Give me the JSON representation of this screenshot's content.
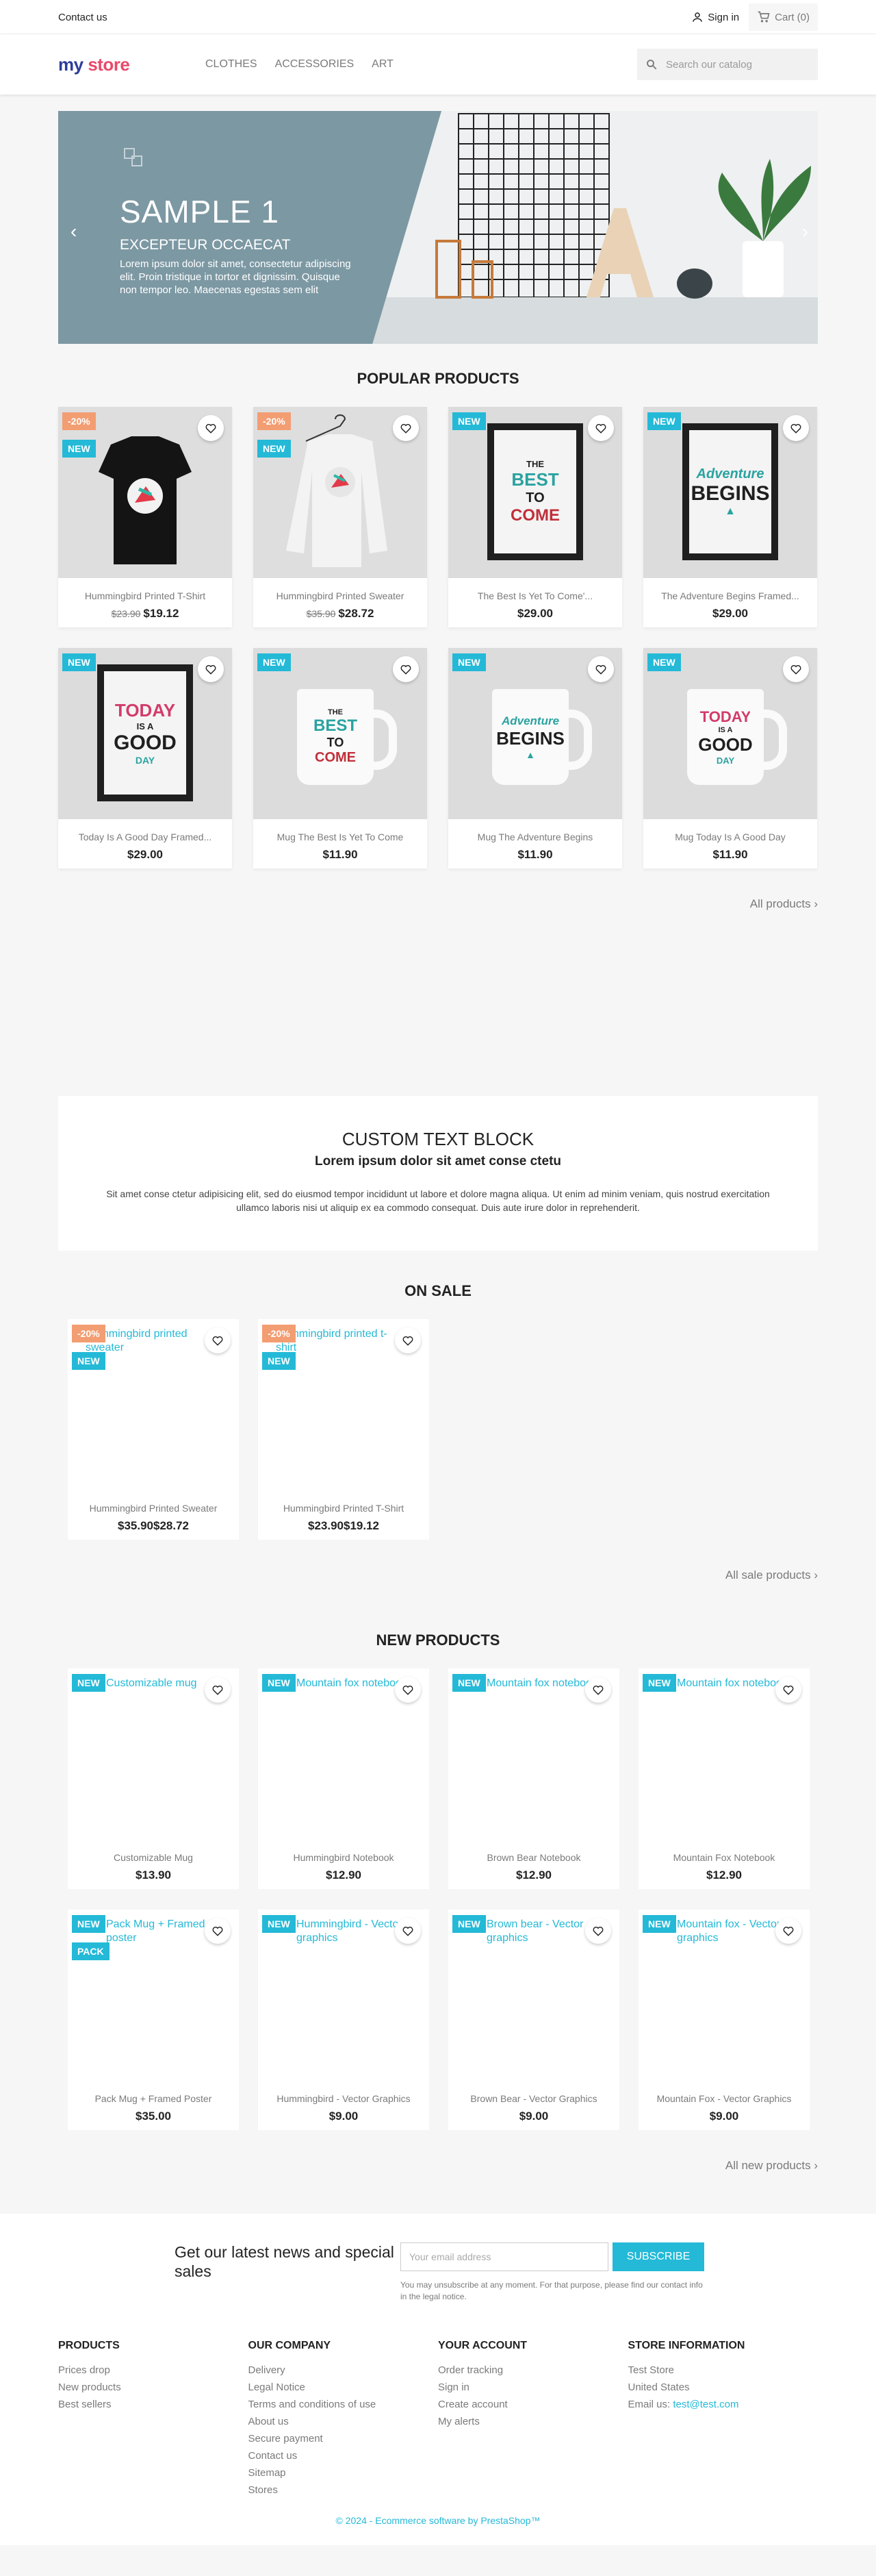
{
  "header": {
    "contact": "Contact us",
    "signin": "Sign in",
    "cart": "Cart (0)",
    "logo_a": "my",
    "logo_b": "store",
    "menu": [
      "CLOTHES",
      "ACCESSORIES",
      "ART"
    ],
    "search_placeholder": "Search our catalog"
  },
  "slider": {
    "title": "SAMPLE 1",
    "subtitle": "EXCEPTEUR OCCAECAT",
    "text": "Lorem ipsum dolor sit amet, consectetur adipiscing elit. Proin tristique in tortor et dignissim. Quisque non tempor leo. Maecenas egestas sem elit"
  },
  "popular": {
    "title": "POPULAR PRODUCTS",
    "products": [
      {
        "name": "Hummingbird Printed T-Shirt",
        "old": "$23.90",
        "price": "$19.12",
        "discount": "-20%",
        "flag": "NEW"
      },
      {
        "name": "Hummingbird Printed Sweater",
        "old": "$35.90",
        "price": "$28.72",
        "discount": "-20%",
        "flag": "NEW"
      },
      {
        "name": "The Best Is Yet To Come'...",
        "price": "$29.00",
        "flag": "NEW"
      },
      {
        "name": "The Adventure Begins Framed...",
        "price": "$29.00",
        "flag": "NEW"
      },
      {
        "name": "Today Is A Good Day Framed...",
        "price": "$29.00",
        "flag": "NEW"
      },
      {
        "name": "Mug The Best Is Yet To Come",
        "price": "$11.90",
        "flag": "NEW"
      },
      {
        "name": "Mug The Adventure Begins",
        "price": "$11.90",
        "flag": "NEW"
      },
      {
        "name": "Mug Today Is A Good Day",
        "price": "$11.90",
        "flag": "NEW"
      }
    ],
    "all_link": "All products"
  },
  "custom": {
    "title": "CUSTOM TEXT BLOCK",
    "subtitle": "Lorem ipsum dolor sit amet conse ctetu",
    "text": "Sit amet conse ctetur adipisicing elit, sed do eiusmod tempor incididunt ut labore et dolore magna aliqua. Ut enim ad minim veniam, quis nostrud exercitation ullamco laboris nisi ut aliquip ex ea commodo consequat. Duis aute irure dolor in reprehenderit."
  },
  "sale": {
    "title": "ON SALE",
    "products": [
      {
        "name": "Hummingbird Printed Sweater",
        "old": "$35.90",
        "price": "$28.72",
        "discount": "-20%",
        "flag": "NEW",
        "alt": "Hummingbird printed sweater"
      },
      {
        "name": "Hummingbird Printed T-Shirt",
        "old": "$23.90",
        "price": "$19.12",
        "discount": "-20%",
        "flag": "NEW",
        "alt": "Hummingbird printed t-shirt"
      }
    ],
    "all_link": "All sale products"
  },
  "new_products": {
    "title": "NEW PRODUCTS",
    "products": [
      {
        "name": "Customizable Mug",
        "price": "$13.90",
        "flag": "NEW",
        "alt": "Customizable mug"
      },
      {
        "name": "Hummingbird Notebook",
        "price": "$12.90",
        "flag": "NEW",
        "alt": "Mountain fox notebook"
      },
      {
        "name": "Brown Bear Notebook",
        "price": "$12.90",
        "flag": "NEW",
        "alt": "Mountain fox notebook"
      },
      {
        "name": "Mountain Fox Notebook",
        "price": "$12.90",
        "flag": "NEW",
        "alt": "Mountain fox notebook"
      },
      {
        "name": "Pack Mug + Framed Poster",
        "price": "$35.00",
        "flag": "NEW",
        "pack": "PACK",
        "alt": "Pack Mug + Framed poster"
      },
      {
        "name": "Hummingbird - Vector Graphics",
        "price": "$9.00",
        "flag": "NEW",
        "alt": "Hummingbird - Vector graphics"
      },
      {
        "name": "Brown Bear - Vector Graphics",
        "price": "$9.00",
        "flag": "NEW",
        "alt": "Brown bear - Vector graphics"
      },
      {
        "name": "Mountain Fox - Vector Graphics",
        "price": "$9.00",
        "flag": "NEW",
        "alt": "Mountain fox - Vector graphics"
      }
    ],
    "all_link": "All new products"
  },
  "newsletter": {
    "title": "Get our latest news and special sales",
    "placeholder": "Your email address",
    "button": "SUBSCRIBE",
    "note": "You may unsubscribe at any moment. For that purpose, please find our contact info in the legal notice."
  },
  "footer": {
    "products": {
      "title": "PRODUCTS",
      "items": [
        "Prices drop",
        "New products",
        "Best sellers"
      ]
    },
    "company": {
      "title": "OUR COMPANY",
      "items": [
        "Delivery",
        "Legal Notice",
        "Terms and conditions of use",
        "About us",
        "Secure payment",
        "Contact us",
        "Sitemap",
        "Stores"
      ]
    },
    "account": {
      "title": "YOUR ACCOUNT",
      "items": [
        "Order tracking",
        "Sign in",
        "Create account",
        "My alerts"
      ]
    },
    "store": {
      "title": "STORE INFORMATION",
      "lines": [
        "Test Store",
        "United States"
      ],
      "email_label": "Email us:",
      "email": "test@test.com"
    },
    "copyright": "© 2024 - Ecommerce software by PrestaShop™"
  },
  "colors": {
    "accent": "#24b9d7",
    "discount": "#f39d72",
    "slide": "#7c98a3"
  }
}
